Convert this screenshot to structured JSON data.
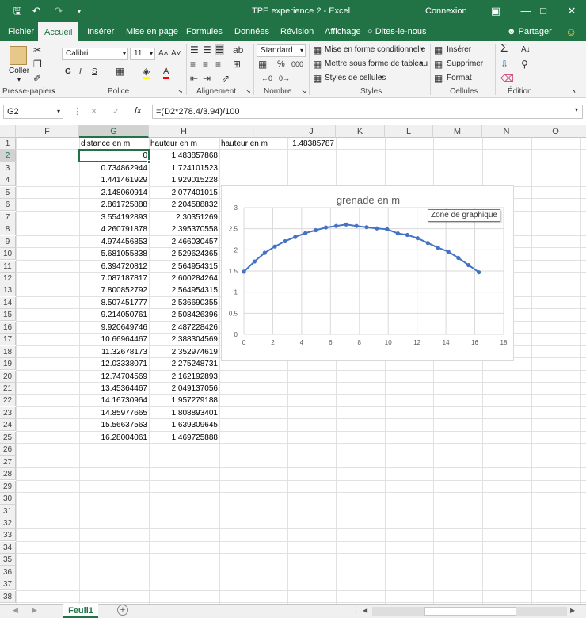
{
  "window": {
    "title": "TPE experience 2  -  Excel",
    "account": "Connexion"
  },
  "tabs": [
    "Fichier",
    "Accueil",
    "Insérer",
    "Mise en page",
    "Formules",
    "Données",
    "Révision",
    "Affichage",
    "Dites-le-nous",
    "Partager"
  ],
  "ribbon": {
    "clipboard": {
      "paste": "Coller",
      "label": "Presse-papiers"
    },
    "font": {
      "name": "Calibri",
      "size": "11",
      "bold": "G",
      "italic": "I",
      "underline": "S",
      "label": "Police"
    },
    "alignment": {
      "label": "Alignement"
    },
    "number": {
      "format": "Standard",
      "percent": "%",
      "thousands": "000",
      "label": "Nombre"
    },
    "styles": {
      "conditional": "Mise en forme conditionnelle",
      "table": "Mettre sous forme de tableau",
      "cell": "Styles de cellules",
      "label": "Styles"
    },
    "cells": {
      "insert": "Insérer",
      "delete": "Supprimer",
      "format": "Format",
      "label": "Cellules"
    },
    "editing": {
      "label": "Édition"
    }
  },
  "formula_bar": {
    "name_box": "G2",
    "fx": "fx",
    "formula": "=(D2*278.4/3.94)/100"
  },
  "columns": [
    "F",
    "G",
    "H",
    "I",
    "J",
    "K",
    "L",
    "M",
    "N",
    "O"
  ],
  "rows": [
    "1",
    "2",
    "3",
    "4",
    "5",
    "6",
    "7",
    "8",
    "9",
    "10",
    "11",
    "12",
    "13",
    "14",
    "15",
    "16",
    "17",
    "18",
    "19",
    "20",
    "21",
    "22",
    "23",
    "24",
    "25",
    "26",
    "27",
    "28",
    "29",
    "30",
    "31",
    "32",
    "33",
    "34",
    "35",
    "36",
    "37",
    "38"
  ],
  "cells": {
    "G1": "distance  en m",
    "H1": "hauteur en m",
    "I1": "hauteur en m",
    "J1": "1.48385787",
    "G": [
      "0",
      "0.734862944",
      "1.441461929",
      "2.148060914",
      "2.861725888",
      "3.554192893",
      "4.260791878",
      "4.974456853",
      "5.681055838",
      "6.394720812",
      "7.087187817",
      "7.800852792",
      "8.507451777",
      "9.214050761",
      "9.920649746",
      "10.66964467",
      "11.32678173",
      "12.03338071",
      "12.74704569",
      "13.45364467",
      "14.16730964",
      "14.85977665",
      "15.56637563",
      "16.28004061"
    ],
    "H": [
      "1.483857868",
      "1.724101523",
      "1.929015228",
      "2.077401015",
      "2.204588832",
      "2.30351269",
      "2.395370558",
      "2.466030457",
      "2.529624365",
      "2.564954315",
      "2.600284264",
      "2.564954315",
      "2.536690355",
      "2.508426396",
      "2.487228426",
      "2.388304569",
      "2.352974619",
      "2.275248731",
      "2.162192893",
      "2.049137056",
      "1.957279188",
      "1.808893401",
      "1.639309645",
      "1.469725888"
    ]
  },
  "chart_data": {
    "type": "scatter",
    "title": "grenade en m",
    "xlabel": "",
    "ylabel": "",
    "xlim": [
      0,
      18
    ],
    "ylim": [
      0,
      3
    ],
    "xticks": [
      "0",
      "2",
      "4",
      "6",
      "8",
      "10",
      "12",
      "14",
      "16",
      "18"
    ],
    "yticks": [
      "0",
      "0.5",
      "1",
      "1.5",
      "2",
      "2.5",
      "3"
    ],
    "grid": true,
    "color": "#4472c4",
    "x": [
      0,
      0.734862944,
      1.441461929,
      2.148060914,
      2.861725888,
      3.554192893,
      4.260791878,
      4.974456853,
      5.681055838,
      6.394720812,
      7.087187817,
      7.800852792,
      8.507451777,
      9.214050761,
      9.920649746,
      10.66964467,
      11.32678173,
      12.03338071,
      12.74704569,
      13.45364467,
      14.16730964,
      14.85977665,
      15.56637563,
      16.28004061
    ],
    "y": [
      1.483857868,
      1.724101523,
      1.929015228,
      2.077401015,
      2.204588832,
      2.30351269,
      2.395370558,
      2.466030457,
      2.529624365,
      2.564954315,
      2.600284264,
      2.564954315,
      2.536690355,
      2.508426396,
      2.487228426,
      2.388304569,
      2.352974619,
      2.275248731,
      2.162192893,
      2.049137056,
      1.957279188,
      1.808893401,
      1.639309645,
      1.469725888
    ]
  },
  "chart_tooltip": "Zone de graphique",
  "sheet_tab": "Feuil1",
  "add_sheet": "+"
}
